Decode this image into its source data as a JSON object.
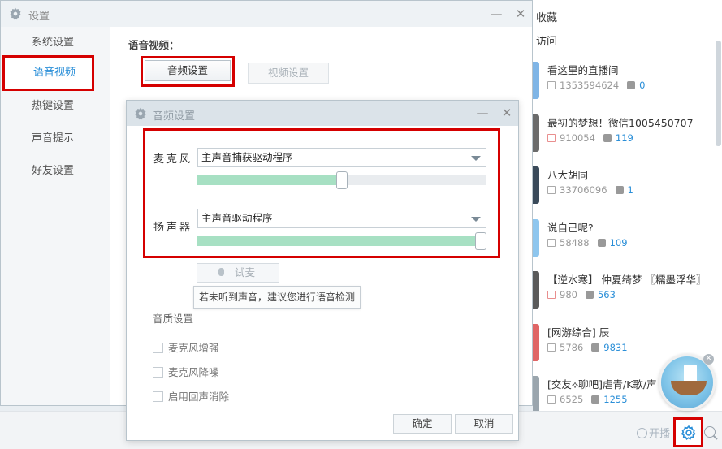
{
  "background": {
    "header_favorites": "收藏",
    "header_visits": "访问",
    "channels": [
      {
        "title": "看这里的直播间",
        "id": "1353594624",
        "count": "0",
        "id_style": "gray",
        "thumb": "#7fb5e6"
      },
      {
        "title": "最初的梦想！微信1005450707",
        "id": "910054",
        "count": "119",
        "id_style": "red",
        "thumb": "#6b6b6b"
      },
      {
        "title": "八大胡同",
        "id": "33706096",
        "count": "1",
        "id_style": "gray",
        "thumb": "#3a4a5a"
      },
      {
        "title": "说自己呢?",
        "id": "58488",
        "count": "109",
        "id_style": "gray",
        "thumb": "#8ec6ee"
      },
      {
        "title": "【逆水寒】 仲夏绮梦 〖糯墨浮华〗",
        "id": "980",
        "count": "563",
        "id_style": "red",
        "thumb": "#5a5a5a"
      },
      {
        "title": "[网游综合]     辰",
        "id": "5786",
        "count": "9831",
        "id_style": "gray",
        "thumb": "#e06666"
      },
      {
        "title": "[交友⟡聊吧]虐青/K歌/声",
        "id": "6525",
        "count": "1255",
        "id_style": "gray",
        "thumb": "#9aa5ad"
      }
    ],
    "open_label": "开播",
    "gear_icon": "gear-icon",
    "search_icon": "search-icon"
  },
  "settings": {
    "title": "设置",
    "sidebar": [
      {
        "label": "系统设置",
        "active": false
      },
      {
        "label": "语音视频",
        "active": true
      },
      {
        "label": "热键设置",
        "active": false
      },
      {
        "label": "声音提示",
        "active": false
      },
      {
        "label": "好友设置",
        "active": false
      }
    ],
    "section_label": "语音视频：",
    "tabs": {
      "audio": "音频设置",
      "video": "视频设置"
    }
  },
  "audio_dialog": {
    "title": "音频设置",
    "mic_label": "麦克风",
    "mic_device": "主声音捕获驱动程序",
    "mic_volume": 0.5,
    "speaker_label": "扬声器",
    "speaker_device": "主声音驱动程序",
    "speaker_volume": 1.0,
    "test_button": "试麦",
    "tooltip": "若未听到声音，建议您进行语音检测",
    "quality_label": "音质设置",
    "options": [
      "麦克风增强",
      "麦克风降噪",
      "启用回声消除"
    ],
    "confirm": "确定",
    "cancel": "取消"
  },
  "colors": {
    "accent": "#2b8fd8",
    "highlight": "#d50000",
    "slider_fill": "#a7e0c3"
  }
}
